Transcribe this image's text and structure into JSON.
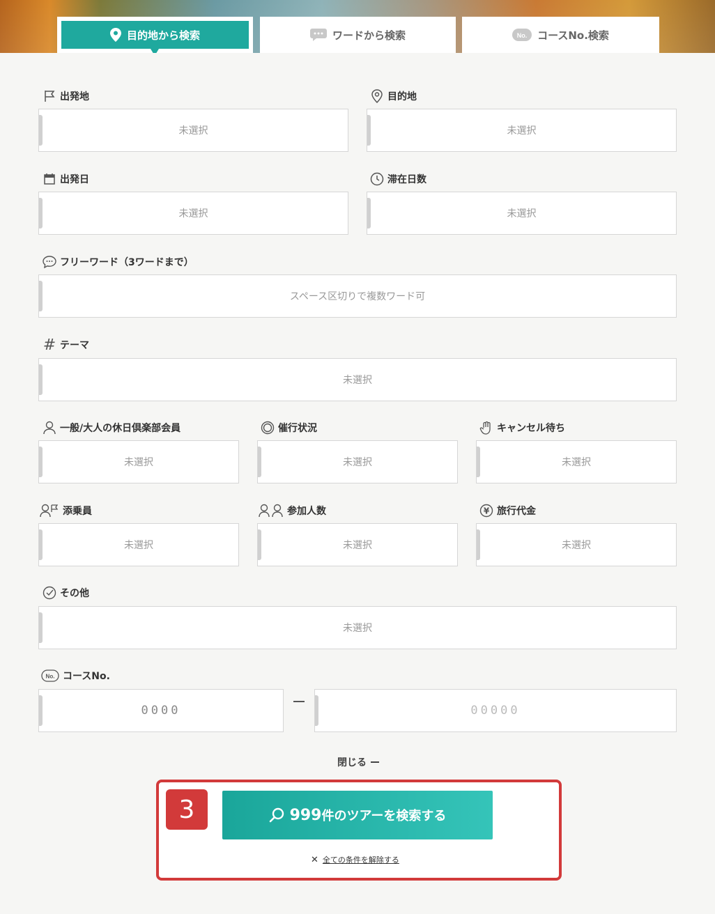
{
  "tabs": [
    {
      "label": "目的地から検索",
      "icon": "map-pin-icon",
      "active": true
    },
    {
      "label": "ワードから検索",
      "icon": "chat-bubble-icon",
      "active": false
    },
    {
      "label": "コースNo.検索",
      "icon": "no-badge-icon",
      "active": false
    }
  ],
  "fields": {
    "departure": {
      "label": "出発地",
      "value": "未選択",
      "icon": "flag-icon"
    },
    "destination": {
      "label": "目的地",
      "value": "未選択",
      "icon": "location-pin-icon"
    },
    "date": {
      "label": "出発日",
      "value": "未選択",
      "icon": "calendar-icon"
    },
    "stay": {
      "label": "滞在日数",
      "value": "未選択",
      "icon": "clock-icon"
    },
    "freeword": {
      "label": "フリーワード（3ワードまで）",
      "placeholder": "スペース区切りで複数ワード可",
      "icon": "speech-bubble-icon"
    },
    "theme": {
      "label": "テーマ",
      "value": "未選択",
      "icon": "hash-icon"
    },
    "member": {
      "label": "一般/大人の休日倶楽部会員",
      "value": "未選択",
      "icon": "person-icon"
    },
    "status": {
      "label": "催行状況",
      "value": "未選択",
      "icon": "target-icon"
    },
    "cancel_wait": {
      "label": "キャンセル待ち",
      "value": "未選択",
      "icon": "hand-icon"
    },
    "conductor": {
      "label": "添乗員",
      "value": "未選択",
      "icon": "guide-flag-icon"
    },
    "participants": {
      "label": "参加人数",
      "value": "未選択",
      "icon": "people-icon"
    },
    "price": {
      "label": "旅行代金",
      "value": "未選択",
      "icon": "yen-icon"
    },
    "other": {
      "label": "その他",
      "value": "未選択",
      "icon": "check-circle-icon"
    },
    "course_no": {
      "label": "コースNo.",
      "placeholder1": "0000",
      "placeholder2": "00000",
      "icon": "no-badge-icon"
    }
  },
  "close_label": "閉じる",
  "search": {
    "count": "999",
    "label_suffix": "件のツアーを検索する",
    "icon": "search-icon"
  },
  "clear_label": "全ての条件を解除する",
  "callout_number": "3",
  "colors": {
    "accent": "#1fa99e",
    "callout": "#d23a3a"
  }
}
